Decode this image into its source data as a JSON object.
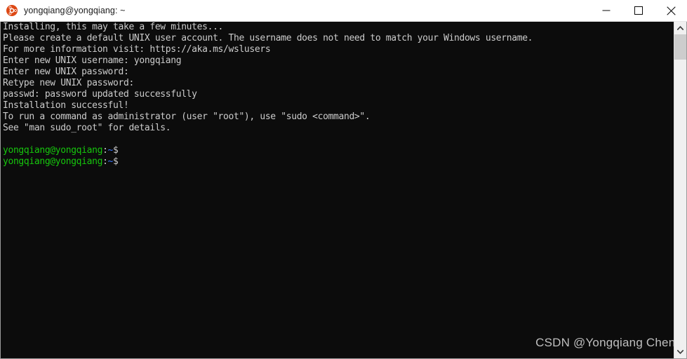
{
  "window": {
    "title": "yongqiang@yongqiang: ~",
    "icon": "ubuntu-logo-icon",
    "controls": {
      "minimize": "minimize-icon",
      "maximize": "maximize-icon",
      "close": "close-icon"
    }
  },
  "terminal": {
    "background_color": "#0c0c0c",
    "foreground_color": "#cccccc",
    "prompt_user_color": "#16c60c",
    "prompt_path_color": "#3b78ff",
    "lines": [
      {
        "segments": [
          {
            "text": "Installing, this may take a few minutes...",
            "color": "white"
          }
        ]
      },
      {
        "segments": [
          {
            "text": "Please create a default UNIX user account. The username does not need to match your Windows username.",
            "color": "white"
          }
        ]
      },
      {
        "segments": [
          {
            "text": "For more information visit: https://aka.ms/wslusers",
            "color": "white"
          }
        ]
      },
      {
        "segments": [
          {
            "text": "Enter new UNIX username: yongqiang",
            "color": "white"
          }
        ]
      },
      {
        "segments": [
          {
            "text": "Enter new UNIX password:",
            "color": "white"
          }
        ]
      },
      {
        "segments": [
          {
            "text": "Retype new UNIX password:",
            "color": "white"
          }
        ]
      },
      {
        "segments": [
          {
            "text": "passwd: password updated successfully",
            "color": "white"
          }
        ]
      },
      {
        "segments": [
          {
            "text": "Installation successful!",
            "color": "white"
          }
        ]
      },
      {
        "segments": [
          {
            "text": "To run a command as administrator (user \"root\"), use \"sudo <command>\".",
            "color": "white"
          }
        ]
      },
      {
        "segments": [
          {
            "text": "See \"man sudo_root\" for details.",
            "color": "white"
          }
        ]
      },
      {
        "segments": [
          {
            "text": "",
            "color": "white"
          }
        ]
      },
      {
        "segments": [
          {
            "text": "yongqiang@yongqiang",
            "color": "green"
          },
          {
            "text": ":",
            "color": "white"
          },
          {
            "text": "~",
            "color": "blue"
          },
          {
            "text": "$ ",
            "color": "white"
          }
        ]
      },
      {
        "segments": [
          {
            "text": "yongqiang@yongqiang",
            "color": "green"
          },
          {
            "text": ":",
            "color": "white"
          },
          {
            "text": "~",
            "color": "blue"
          },
          {
            "text": "$ ",
            "color": "white"
          }
        ]
      }
    ]
  },
  "watermark": {
    "text": "CSDN @Yongqiang Cheng"
  },
  "scrollbar": {
    "up_arrow": "chevron-up-icon",
    "down_arrow": "chevron-down-icon",
    "thumb_position_percent": 0,
    "thumb_size_percent": 8
  }
}
